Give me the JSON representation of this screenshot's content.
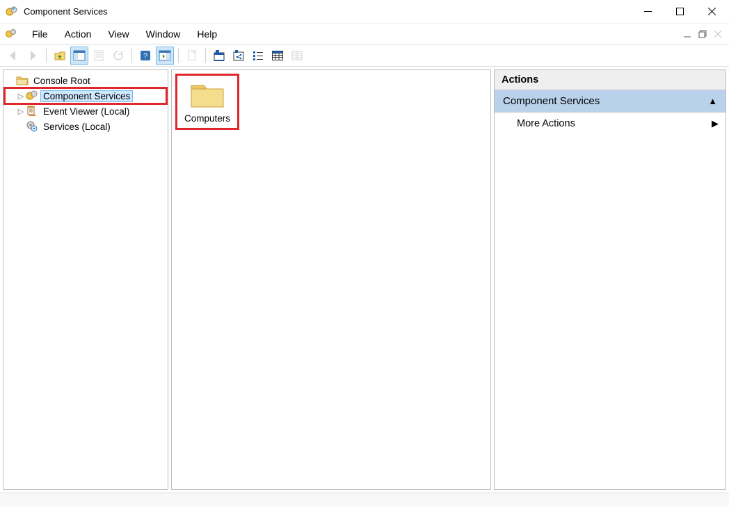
{
  "window": {
    "title": "Component Services"
  },
  "menu": {
    "items": [
      "File",
      "Action",
      "View",
      "Window",
      "Help"
    ]
  },
  "toolbar": {
    "buttons": [
      {
        "name": "back-button",
        "enabled": false
      },
      {
        "name": "forward-button",
        "enabled": false
      },
      {
        "sep": true
      },
      {
        "name": "up-button",
        "enabled": true
      },
      {
        "name": "show-hide-tree-button",
        "enabled": true,
        "active": true
      },
      {
        "name": "export-list-button",
        "enabled": false
      },
      {
        "name": "refresh-button",
        "enabled": false
      },
      {
        "sep": true
      },
      {
        "name": "help-button",
        "enabled": true
      },
      {
        "name": "show-hide-action-pane-button",
        "enabled": true,
        "active": true
      },
      {
        "sep": true
      },
      {
        "name": "new-object-button",
        "enabled": false
      },
      {
        "sep": true
      },
      {
        "name": "view-app-button",
        "enabled": true
      },
      {
        "name": "view-components-button",
        "enabled": true
      },
      {
        "name": "view-list-button",
        "enabled": true
      },
      {
        "name": "view-detail-button",
        "enabled": true
      },
      {
        "name": "view-property-button",
        "enabled": false
      }
    ]
  },
  "tree": {
    "root": {
      "label": "Console Root"
    },
    "children": [
      {
        "label": "Component Services",
        "selected": true,
        "highlight": true,
        "icon": "component-services-icon"
      },
      {
        "label": "Event Viewer (Local)",
        "icon": "event-viewer-icon"
      },
      {
        "label": "Services (Local)",
        "icon": "services-icon"
      }
    ]
  },
  "content": {
    "items": [
      {
        "label": "Computers",
        "icon": "folder-icon",
        "highlight": true
      }
    ]
  },
  "actions": {
    "header": "Actions",
    "section": "Component Services",
    "rows": [
      {
        "label": "More Actions",
        "has_submenu": true
      }
    ]
  }
}
